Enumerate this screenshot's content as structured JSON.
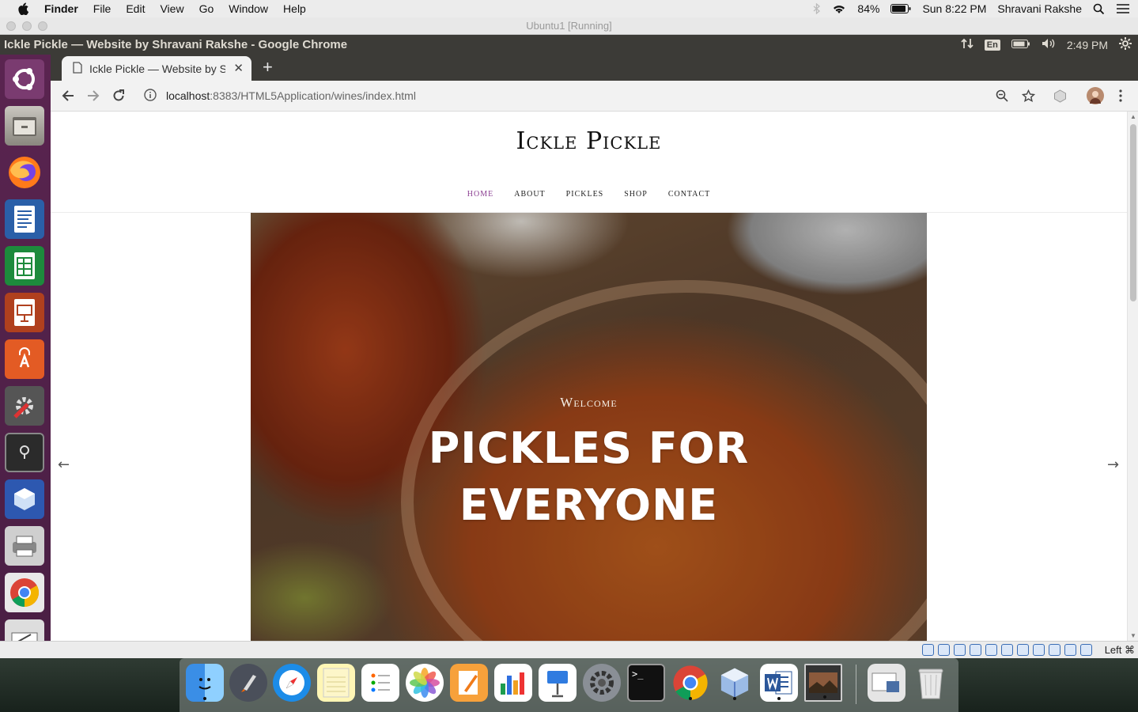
{
  "mac_menubar": {
    "app": "Finder",
    "menus": [
      "File",
      "Edit",
      "View",
      "Go",
      "Window",
      "Help"
    ],
    "battery": "84%",
    "clock": "Sun 8:22 PM",
    "user": "Shravani Rakshe"
  },
  "vbox": {
    "title": "Ubuntu1 [Running]",
    "host_key": "Left ⌘"
  },
  "ubuntu_panel": {
    "window_title": "Ickle Pickle — Website by Shravani Rakshe - Google Chrome",
    "language": "En",
    "time": "2:49 PM"
  },
  "browser": {
    "tab_title": "Ickle Pickle — Website by Shravani Rakshe",
    "url_host": "localhost",
    "url_path": ":8383/HTML5Application/wines/index.html"
  },
  "site": {
    "logo": "Ickle Pickle",
    "nav": [
      "HOME",
      "ABOUT",
      "PICKLES",
      "SHOP",
      "CONTACT"
    ],
    "active_nav": "HOME",
    "hero_welcome": "Welcome",
    "hero_line1": "PICKLES FOR",
    "hero_line2": "EVERYONE",
    "prev_arrow": "←",
    "next_arrow": "→"
  },
  "colors": {
    "accent": "#8a3d91",
    "ubuntu_panel": "#3c3b37",
    "launcher": "#5a2450"
  },
  "launcher_icons": [
    "ubuntu-dash-icon",
    "files-icon",
    "firefox-icon",
    "writer-icon",
    "calc-icon",
    "impress-icon",
    "software-center-icon",
    "system-settings-icon",
    "terminal-icon",
    "virtualbox-icon",
    "printer-icon",
    "chrome-icon",
    "text-editor-icon"
  ],
  "dock_icons": [
    "finder-icon",
    "launchpad-icon",
    "safari-icon",
    "notes-icon",
    "reminders-icon",
    "photos-icon",
    "pages-icon",
    "numbers-icon",
    "keynote-icon",
    "system-preferences-icon",
    "terminal-icon",
    "chrome-icon",
    "virtualbox-icon",
    "word-icon",
    "preview-icon",
    "downloads-icon",
    "trash-icon"
  ]
}
